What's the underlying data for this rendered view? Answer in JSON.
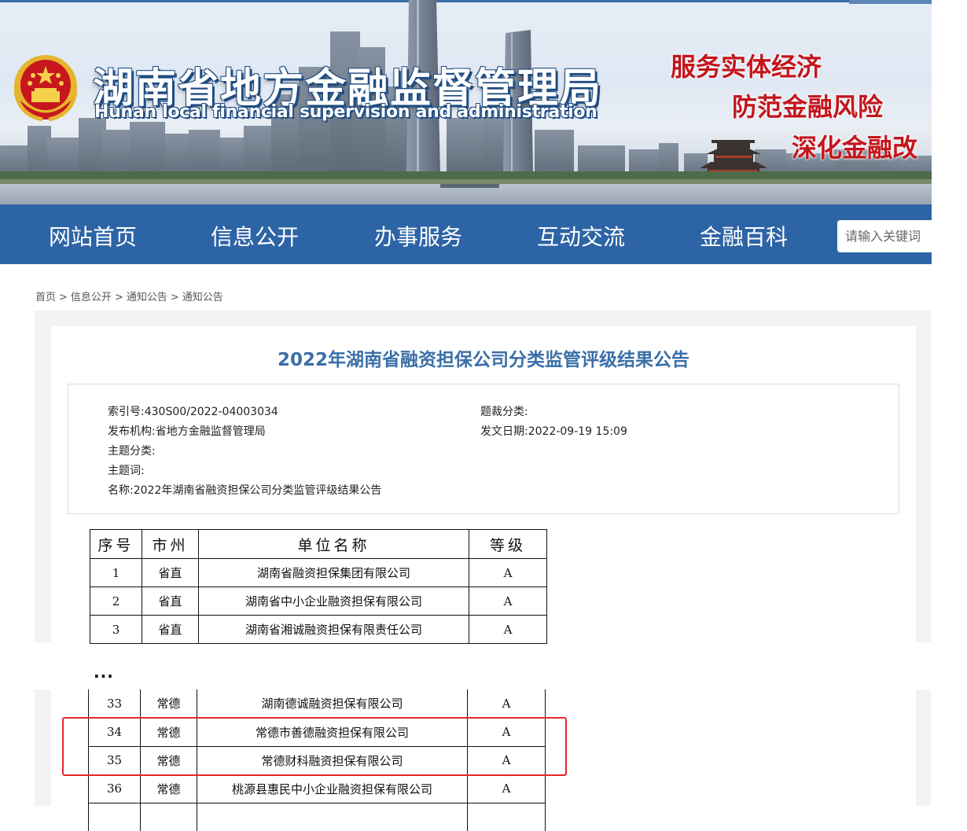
{
  "header": {
    "site_title": "湖南省地方金融监督管理局",
    "site_subtitle": "Hunan local financial supervision and administration",
    "slogans": [
      "服务实体经济",
      "防范金融风险",
      "深化金融改"
    ],
    "colors": {
      "nav_bg": "#2d64a5",
      "slogan": "#c3161c",
      "title_blue": "#3a6fa8"
    }
  },
  "nav": {
    "items": [
      "网站首页",
      "信息公开",
      "办事服务",
      "互动交流",
      "金融百科"
    ],
    "search_placeholder": "请输入关键词"
  },
  "breadcrumb": [
    "首页",
    "信息公开",
    "通知公告",
    "通知公告"
  ],
  "article": {
    "title": "2022年湖南省融资担保公司分类监管评级结果公告",
    "meta": {
      "index_label": "索引号:",
      "index_value": "430S00/2022-04003034",
      "genre_label": "题裁分类:",
      "genre_value": "",
      "org_label": "发布机构:",
      "org_value": "省地方金融监督管理局",
      "date_label": "发文日期:",
      "date_value": "2022-09-19 15:09",
      "topic_label": "主题分类:",
      "topic_value": "",
      "keyword_label": "主题词:",
      "keyword_value": "",
      "name_label": "名称:",
      "name_value": "2022年湖南省融资担保公司分类监管评级结果公告"
    }
  },
  "table": {
    "headers": [
      "序号",
      "市州",
      "单位名称",
      "等级"
    ],
    "top_rows": [
      [
        "1",
        "省直",
        "湖南省融资担保集团有限公司",
        "A"
      ],
      [
        "2",
        "省直",
        "湖南省中小企业融资担保有限公司",
        "A"
      ],
      [
        "3",
        "省直",
        "湖南省湘诚融资担保有限责任公司",
        "A"
      ]
    ],
    "ellipsis": "...",
    "bottom_rows": [
      [
        "33",
        "常德",
        "湖南德诚融资担保有限公司",
        "A"
      ],
      [
        "34",
        "常德",
        "常德市善德融资担保有限公司",
        "A"
      ],
      [
        "35",
        "常德",
        "常德财科融资担保有限公司",
        "A"
      ],
      [
        "36",
        "常德",
        "桃源县惠民中小企业融资担保有限公司",
        "A"
      ]
    ],
    "highlighted_rows": [
      "34",
      "35"
    ],
    "highlight_color": "#e3262a"
  }
}
